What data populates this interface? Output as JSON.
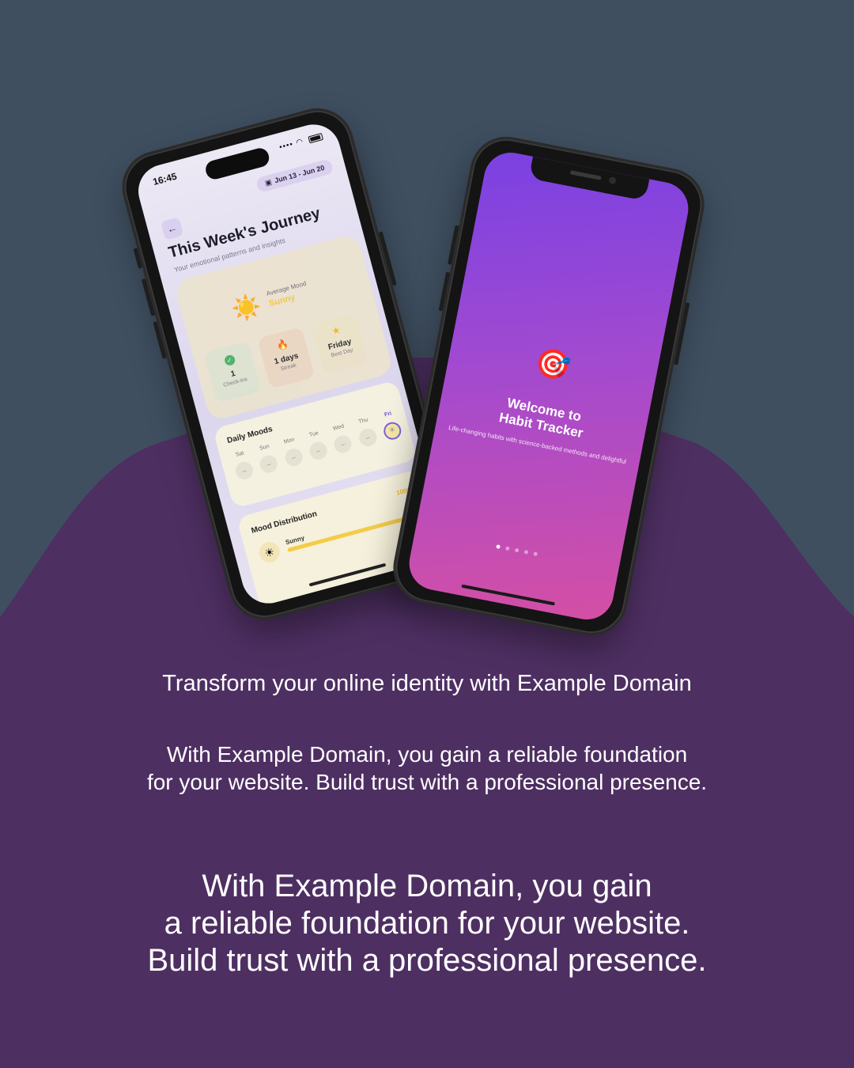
{
  "colors": {
    "background": "#3f4f60",
    "blob": "#4e2f62",
    "text": "#ffffff"
  },
  "mood_app": {
    "status_time": "16:45",
    "date_range": "Jun 13 - Jun 20",
    "title": "This Week's Journey",
    "subtitle": "Your emotional patterns and insights",
    "average_mood_label": "Average Mood",
    "average_mood_value": "Sunny",
    "stats": [
      {
        "value": "1",
        "label": "Check-ins",
        "icon": "check-circle-icon"
      },
      {
        "value": "1 days",
        "label": "Streak",
        "icon": "fire-icon"
      },
      {
        "value": "Friday",
        "label": "Best Day",
        "icon": "star-icon"
      }
    ],
    "daily_moods_title": "Daily Moods",
    "days": [
      {
        "label": "Sat",
        "mark": "–"
      },
      {
        "label": "Sun",
        "mark": "–"
      },
      {
        "label": "Mon",
        "mark": "–"
      },
      {
        "label": "Tue",
        "mark": "–"
      },
      {
        "label": "Wed",
        "mark": "–"
      },
      {
        "label": "Thu",
        "mark": "–"
      },
      {
        "label": "Fri",
        "mark": "☀"
      }
    ],
    "distribution_title": "Mood Distribution",
    "distribution": [
      {
        "mood": "Sunny",
        "percent_label": "100%",
        "fraction": 1.0
      }
    ]
  },
  "habit_app": {
    "welcome_line1": "Welcome to",
    "welcome_line2": "Habit Tracker",
    "subtitle": "Life-changing habits with science-backed methods and delightful",
    "page_count": 5,
    "active_page": 0
  },
  "headline": "Transform your online identity with Example Domain",
  "paragraph1_line1": "With Example Domain, you gain a reliable foundation",
  "paragraph1_line2": "for your website. Build trust with a professional presence.",
  "paragraph2_line1": "With Example Domain, you gain",
  "paragraph2_line2": "a reliable foundation for your website.",
  "paragraph2_line3": "Build trust with a professional presence."
}
